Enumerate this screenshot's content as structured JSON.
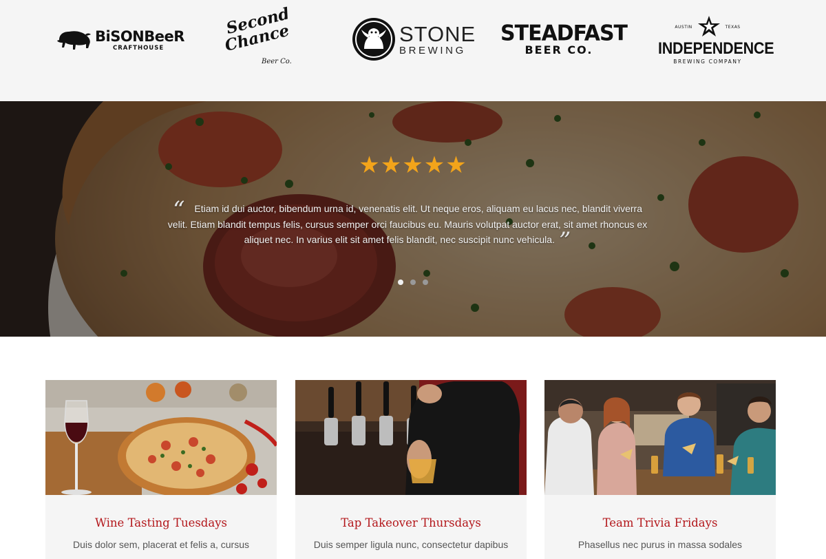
{
  "partners": {
    "bison": {
      "line1": "BiSONBeeR",
      "line2": "CRAFTHOUSE",
      "icon": "bison-icon"
    },
    "second_chance": {
      "line1": "Second",
      "line2": "Chance",
      "line3": "Beer Co.",
      "icon": "script-wordmark"
    },
    "stone": {
      "line1": "STONE",
      "line2": "BREWING",
      "icon": "gargoyle-icon"
    },
    "steadfast": {
      "line1": "STEADFAST",
      "line2": "BEER CO."
    },
    "independence": {
      "left_small": "AUSTIN",
      "right_small": "TEXAS",
      "line1": "INDEPENDENCE",
      "line2": "BREWING COMPANY",
      "icon": "star-icon"
    }
  },
  "testimonial": {
    "stars": "★★★★★",
    "rating": 5,
    "open_quote": "“",
    "close_quote": "”",
    "text": "Etiam id dui auctor, bibendum urna id, venenatis elit. Ut neque eros, aliquam eu lacus nec, blandit viverra velit. Etiam blandit tempus felis, cursus semper orci faucibus eu. Mauris volutpat auctor erat, sit amet rhoncus ex aliquet nec. In varius elit sit amet felis blandit, nec suscipit nunc vehicula.",
    "slides": 3,
    "active_slide": 1
  },
  "events": [
    {
      "title": "Wine Tasting Tuesdays",
      "desc": "Duis dolor sem, placerat et felis a, cursus"
    },
    {
      "title": "Tap Takeover Thursdays",
      "desc": "Duis semper ligula nunc, consectetur dapibus"
    },
    {
      "title": "Team Trivia Fridays",
      "desc": "Phasellus nec purus in massa sodales"
    }
  ],
  "colors": {
    "accent_red": "#b3171b",
    "star_gold": "#f3a41a",
    "strip_bg": "#f5f5f5"
  }
}
